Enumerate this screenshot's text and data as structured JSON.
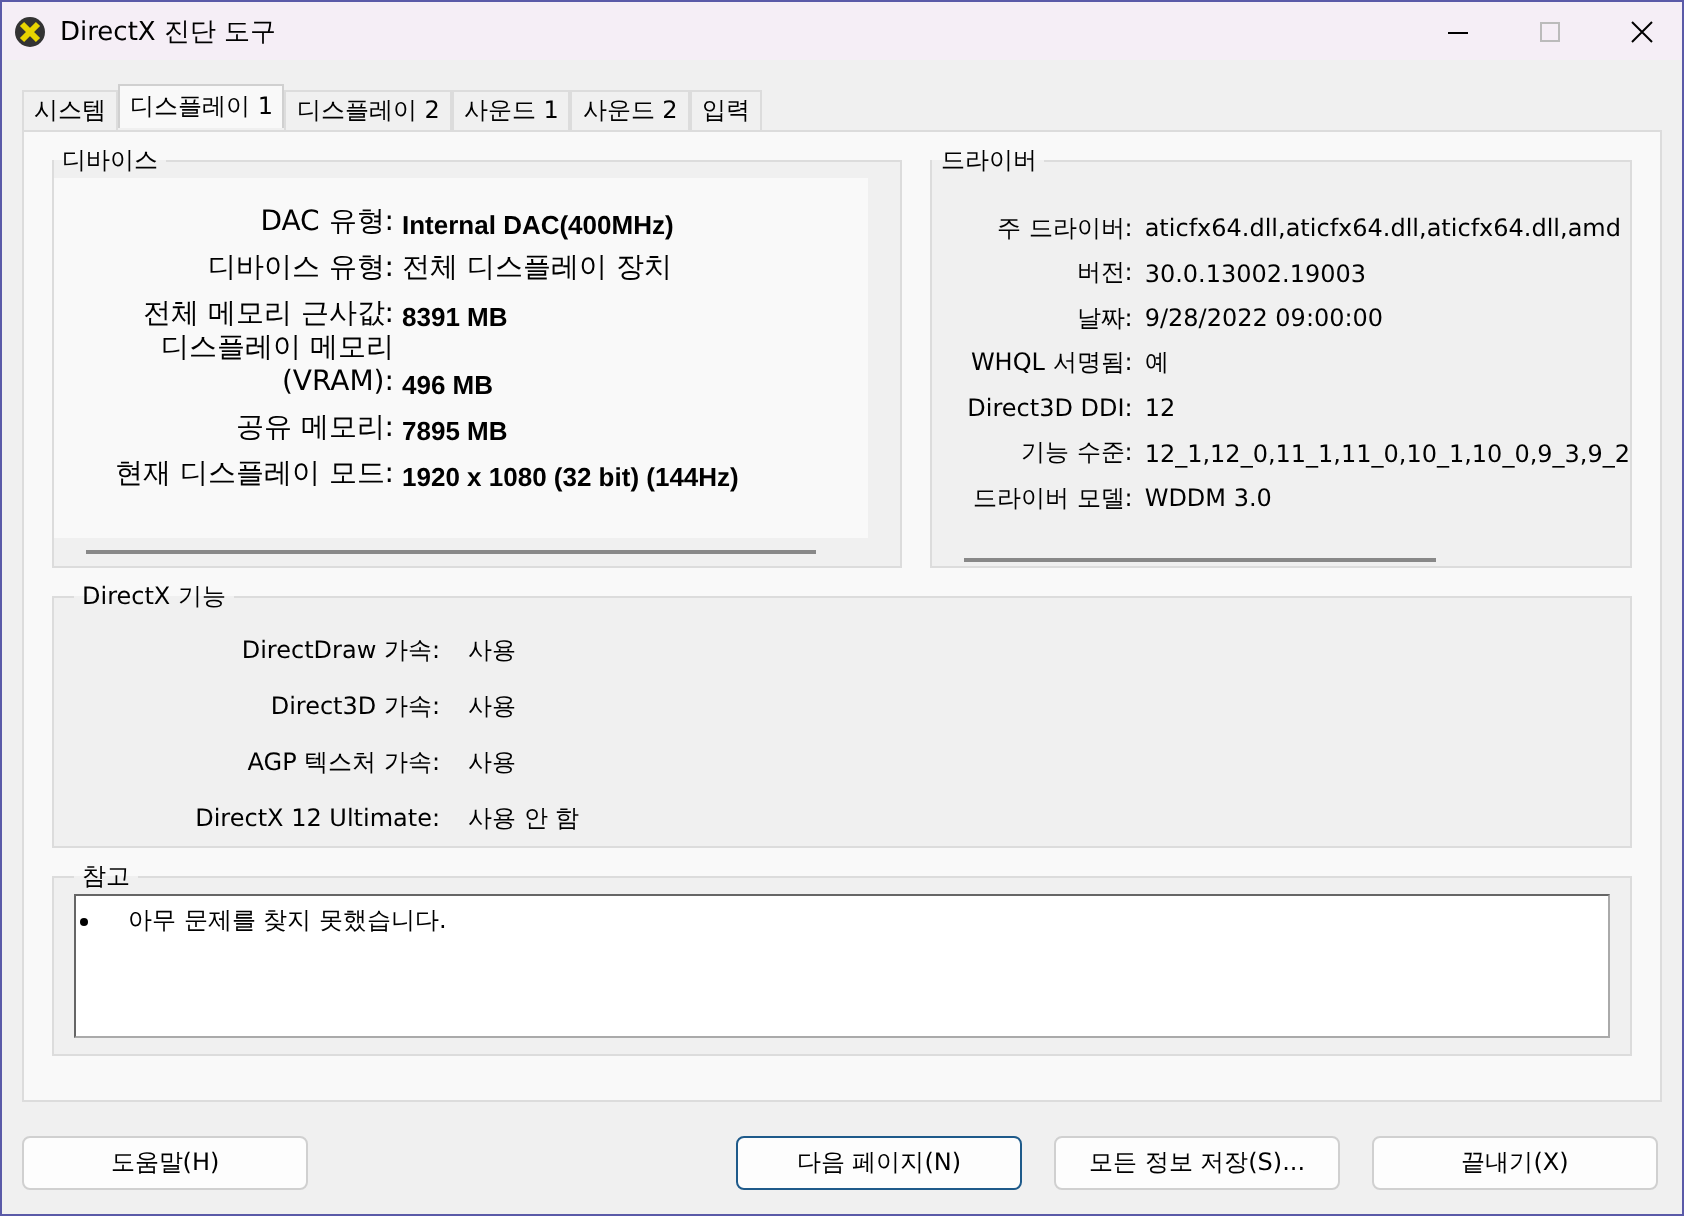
{
  "window": {
    "title": "DirectX 진단 도구"
  },
  "tabs": [
    {
      "label": "시스템",
      "selected": false
    },
    {
      "label": "디스플레이 1",
      "selected": true
    },
    {
      "label": "디스플레이 2",
      "selected": false
    },
    {
      "label": "사운드 1",
      "selected": false
    },
    {
      "label": "사운드 2",
      "selected": false
    },
    {
      "label": "입력",
      "selected": false
    }
  ],
  "device": {
    "title": "디바이스",
    "rows": [
      {
        "label": "DAC 유형:",
        "value": "Internal DAC(400MHz)",
        "bold": true
      },
      {
        "label": "디바이스 유형:",
        "value": "전체 디스플레이 장치",
        "bold": false
      },
      {
        "label": "전체 메모리 근사값:",
        "value": "8391 MB",
        "bold": true
      },
      {
        "label": "디스플레이 메모리(VRAM):",
        "value": "496 MB",
        "bold": true
      },
      {
        "label": "공유 메모리:",
        "value": "7895 MB",
        "bold": true
      },
      {
        "label": "현재 디스플레이 모드:",
        "value": "1920 x 1080 (32 bit) (144Hz)",
        "bold": true
      }
    ]
  },
  "driver": {
    "title": "드라이버",
    "rows": [
      {
        "label": "주 드라이버:",
        "value": "aticfx64.dll,aticfx64.dll,aticfx64.dll,amd"
      },
      {
        "label": "버전:",
        "value": "30.0.13002.19003"
      },
      {
        "label": "날짜:",
        "value": "9/28/2022 09:00:00"
      },
      {
        "label": "WHQL 서명됨:",
        "value": "예"
      },
      {
        "label": "Direct3D DDI:",
        "value": "12"
      },
      {
        "label": "기능 수준:",
        "value": "12_1,12_0,11_1,11_0,10_1,10_0,9_3,9_2"
      },
      {
        "label": "드라이버 모델:",
        "value": "WDDM 3.0"
      }
    ]
  },
  "features": {
    "title": "DirectX 기능",
    "rows": [
      {
        "label": "DirectDraw 가속:",
        "value": "사용"
      },
      {
        "label": "Direct3D 가속:",
        "value": "사용"
      },
      {
        "label": "AGP 텍스처 가속:",
        "value": "사용"
      },
      {
        "label": "DirectX 12 Ultimate:",
        "value": "사용 안 함"
      }
    ]
  },
  "notes": {
    "title": "참고",
    "items": [
      "아무 문제를 찾지 못했습니다."
    ]
  },
  "buttons": [
    {
      "label": "도움말(H)",
      "default": false
    },
    {
      "label": "다음 페이지(N)",
      "default": true
    },
    {
      "label": "모든 정보 저장(S)...",
      "default": false
    },
    {
      "label": "끝내기(X)",
      "default": false
    }
  ]
}
